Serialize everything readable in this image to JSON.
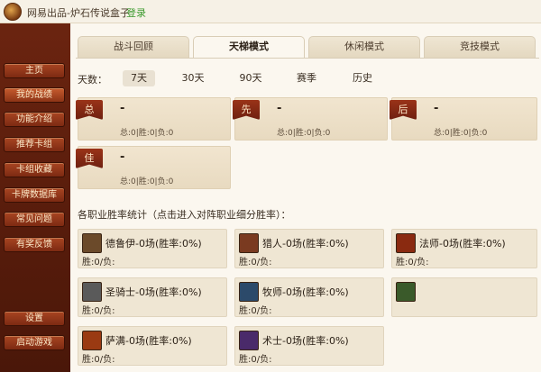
{
  "window": {
    "title": "网易出品-炉石传说盒子",
    "login": "登录"
  },
  "sidebar": {
    "items": [
      "主页",
      "我的战绩",
      "功能介绍",
      "推荐卡组",
      "卡组收藏",
      "卡牌数据库",
      "常见问题",
      "有奖反馈",
      "设置",
      "启动游戏"
    ],
    "active_index": 1
  },
  "tabs": {
    "items": [
      "战斗回顾",
      "天梯模式",
      "休闲模式",
      "竞技模式"
    ],
    "active_index": 1
  },
  "days": {
    "label": "天数：",
    "options": [
      "7天",
      "30天",
      "90天",
      "赛季",
      "历史"
    ],
    "active_index": 0
  },
  "stats": [
    {
      "badge": "总",
      "value": "-",
      "sub": "总:0|胜:0|负:0"
    },
    {
      "badge": "先",
      "value": "-",
      "sub": "总:0|胜:0|负:0"
    },
    {
      "badge": "后",
      "value": "-",
      "sub": "总:0|胜:0|负:0"
    },
    {
      "badge": "佳",
      "value": "-",
      "sub": "总:0|胜:0|负:0"
    }
  ],
  "classes_title": "各职业胜率统计（点击进入对阵职业细分胜率）：",
  "classes": [
    {
      "name": "德鲁伊-0场(胜率:0%)",
      "sub": "胜:0/负:",
      "icon": "druid-icon",
      "color": "#6b4a2a"
    },
    {
      "name": "猎人-0场(胜率:0%)",
      "sub": "胜:0/负:",
      "icon": "hunter-icon",
      "color": "#7a3a20"
    },
    {
      "name": "法师-0场(胜率:0%)",
      "sub": "胜:0/负:",
      "icon": "mage-icon",
      "color": "#8a2a10"
    },
    {
      "name": "圣骑士-0场(胜率:0%)",
      "sub": "胜:0/负:",
      "icon": "paladin-icon",
      "color": "#5a5a5a"
    },
    {
      "name": "牧师-0场(胜率:0%)",
      "sub": "胜:0/负:",
      "icon": "priest-icon",
      "color": "#2c4a6a"
    },
    {
      "name": "",
      "sub": "",
      "icon": "rogue-icon",
      "color": "#3a5a2a"
    },
    {
      "name": "萨满-0场(胜率:0%)",
      "sub": "胜:0/负:",
      "icon": "shaman-icon",
      "color": "#9a3a12"
    },
    {
      "name": "术士-0场(胜率:0%)",
      "sub": "胜:0/负:",
      "icon": "warlock-icon",
      "color": "#4a2a6a"
    }
  ]
}
